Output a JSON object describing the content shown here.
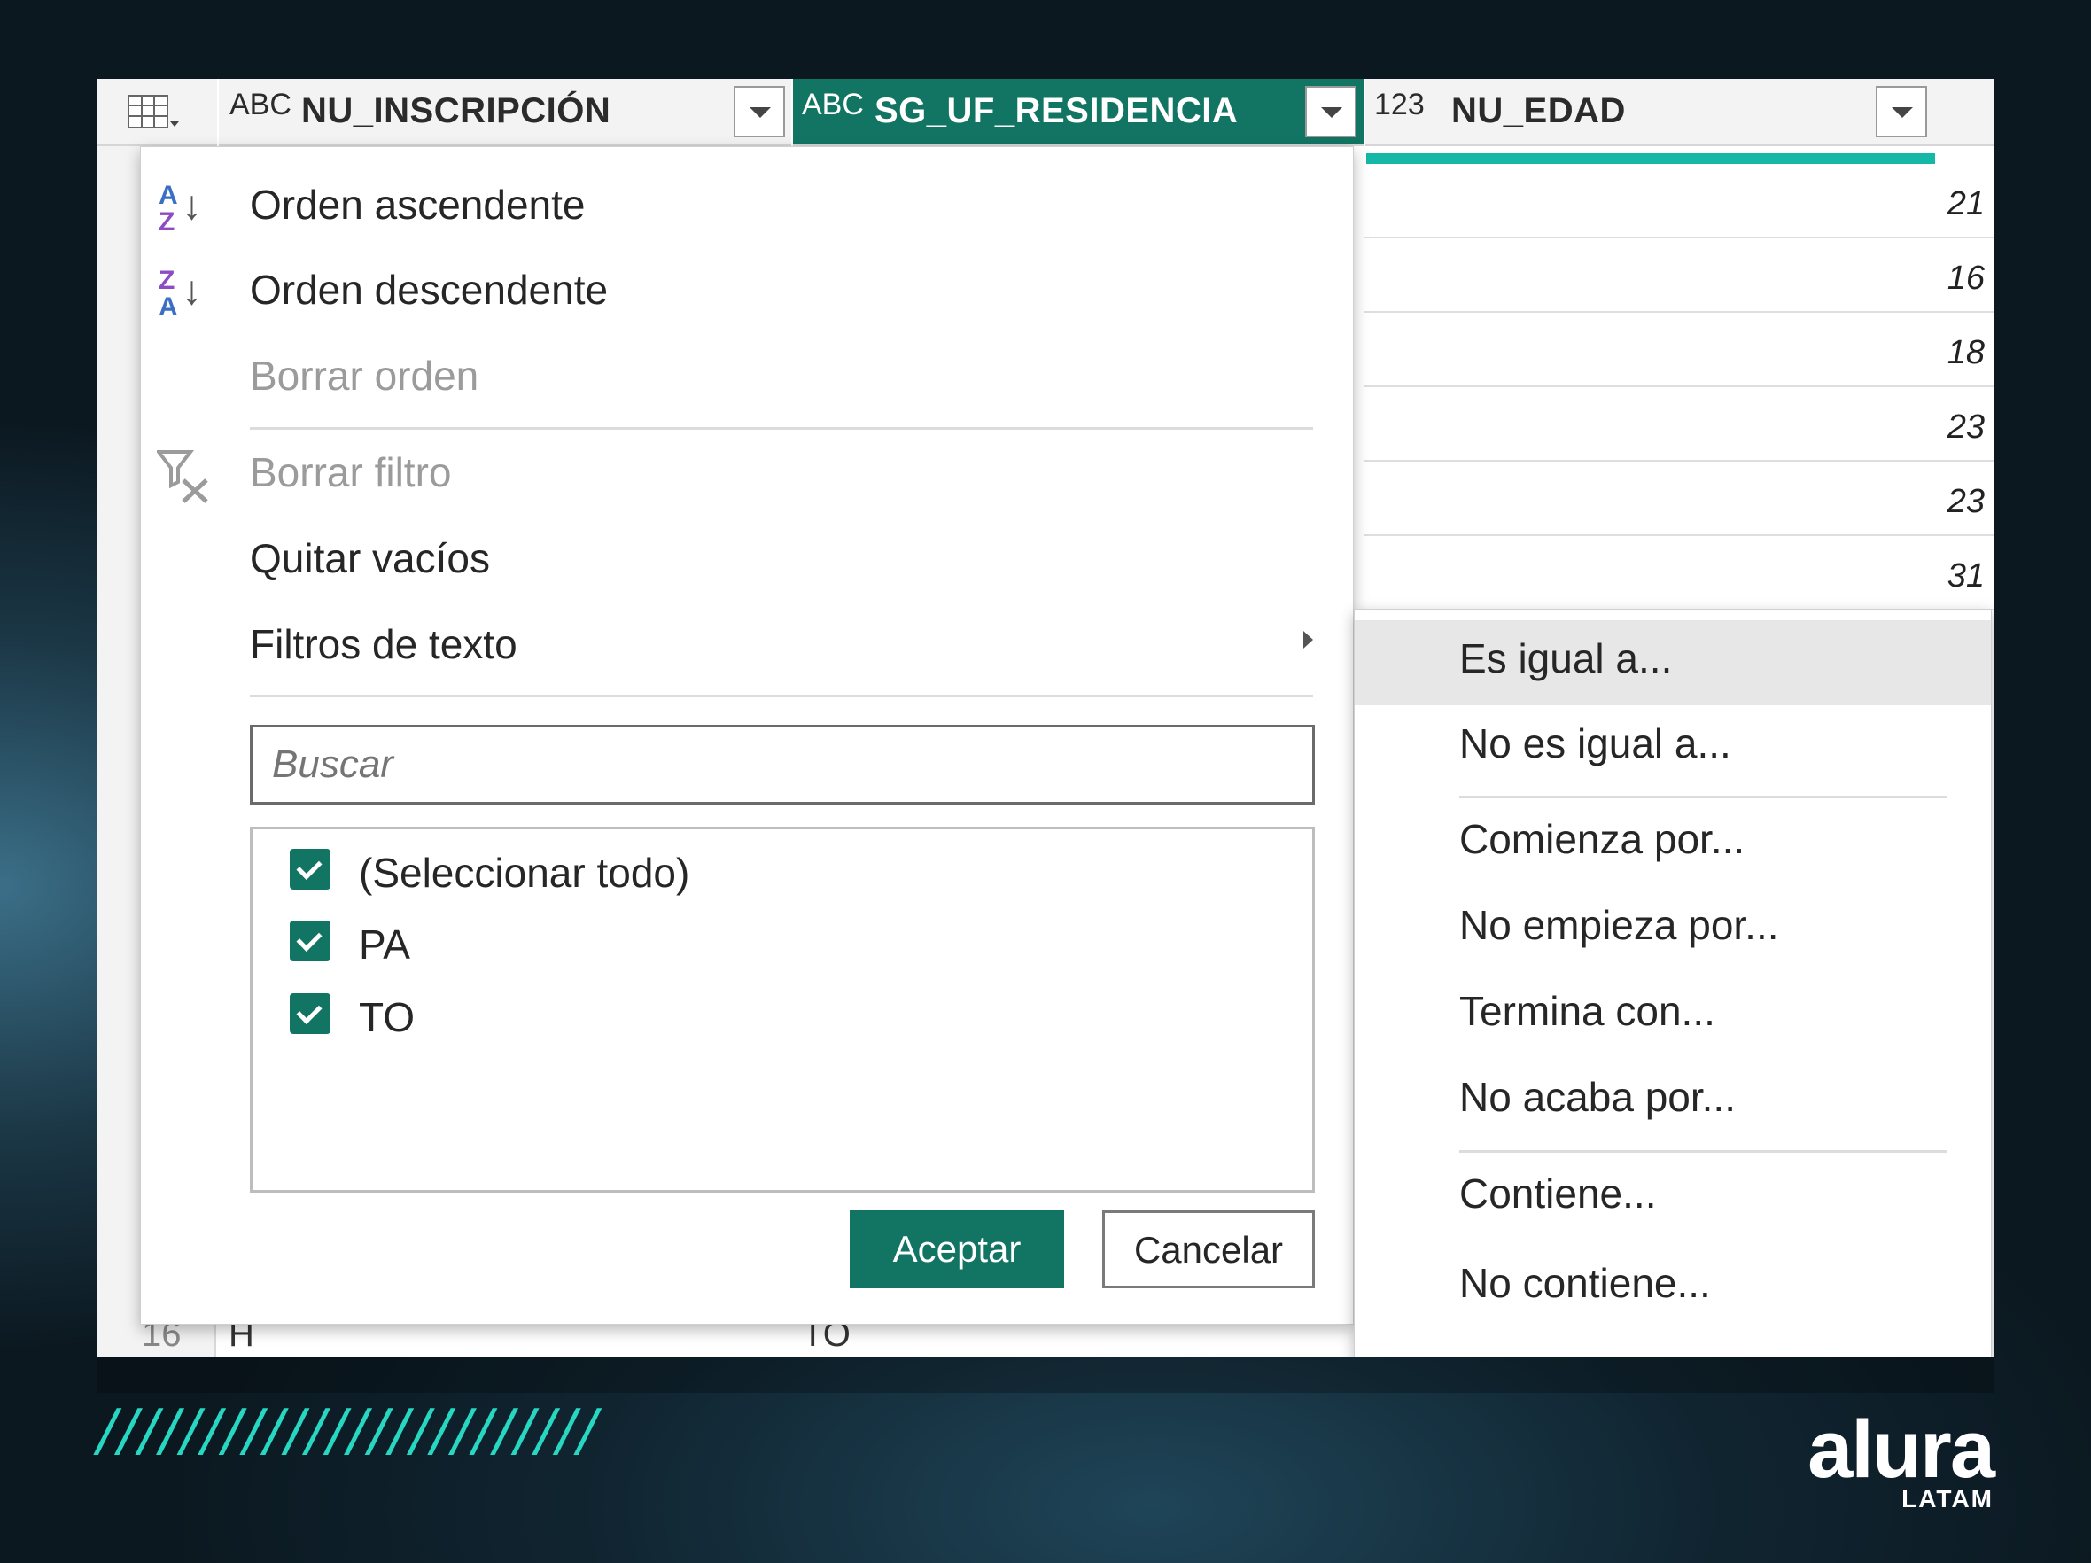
{
  "header": {
    "col1": {
      "type": "ABC",
      "name": "NU_INSCRIPCIÓN"
    },
    "col2": {
      "type": "ABC",
      "name": "SG_UF_RESIDENCIA"
    },
    "col3": {
      "type": "123",
      "name": "NU_EDAD"
    }
  },
  "edad_values": [
    "21",
    "16",
    "18",
    "23",
    "23",
    "31"
  ],
  "menu": {
    "sort_asc": "Orden ascendente",
    "sort_desc": "Orden descendente",
    "clear_sort": "Borrar orden",
    "clear_filter": "Borrar filtro",
    "remove_empty": "Quitar vacíos",
    "text_filters": "Filtros de texto",
    "search_placeholder": "Buscar",
    "list": [
      "(Seleccionar todo)",
      "PA",
      "TO"
    ],
    "ok": "Aceptar",
    "cancel": "Cancelar"
  },
  "submenu": {
    "items": [
      "Es igual a...",
      "No es igual a...",
      "Comienza por...",
      "No empieza por...",
      "Termina con...",
      "No acaba por...",
      "Contiene...",
      "No contiene..."
    ]
  },
  "partial_row": {
    "num": "16",
    "col1": "H",
    "col2": "TO"
  },
  "decor": {
    "stripes": "////////////////////////",
    "logo": "alura",
    "logo_sub": "LATAM"
  },
  "colors": {
    "accent": "#127563",
    "teal": "#15b8a6",
    "stripe": "#27d7c1"
  }
}
